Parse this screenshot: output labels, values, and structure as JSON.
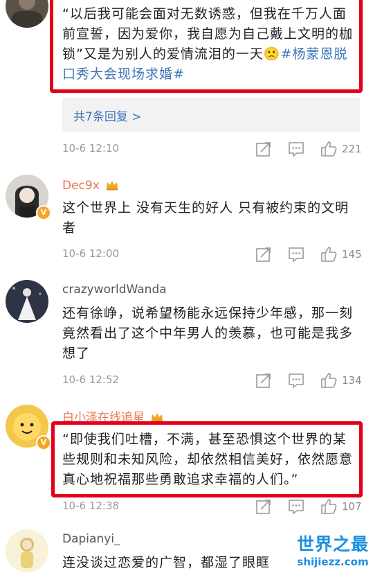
{
  "comments": [
    {
      "username": "",
      "text": "“以后我可能会面对无数诱惑，但我在千万人面前宣誓，因为爱你，我自愿为自己戴上文明的枷锁”又是为别人的爱情流泪的一天",
      "emoji": "🙁",
      "hashtag": "#杨蒙恩脱口秀大会现场求婚#",
      "replies_label": "共7条回复 >",
      "time": "10-6 12:10",
      "likes": "221"
    },
    {
      "username": "Dec9x",
      "text": "这个世界上 没有天生的好人 只有被约束的文明者",
      "time": "10-6 12:00",
      "likes": "145"
    },
    {
      "username": "crazyworldWanda",
      "text": "还有徐峥，说希望杨能永远保持少年感，那一刻竟然看出了这个中年男人的羡慕，也可能是我多想了",
      "time": "10-6 12:52",
      "likes": "134"
    },
    {
      "username": "白小泽在线追星",
      "text": "“即使我们吐槽，不满，甚至恐惧这个世界的某些规则和未知风险，却依然相信美好，依然愿意真心地祝福那些勇敢追求幸福的人们。”",
      "time": "10-6 12:38",
      "likes": "107"
    },
    {
      "username": "Dapianyi_",
      "text": "连没谈过恋爱的广智，都湿了眼眶"
    }
  ],
  "watermark": {
    "logo": "世界之最",
    "url": "shijiezz.com"
  },
  "colors": {
    "highlight": "#e3001b",
    "link": "#3f74b5",
    "username": "#eb7350",
    "badge": "#f5a623"
  }
}
